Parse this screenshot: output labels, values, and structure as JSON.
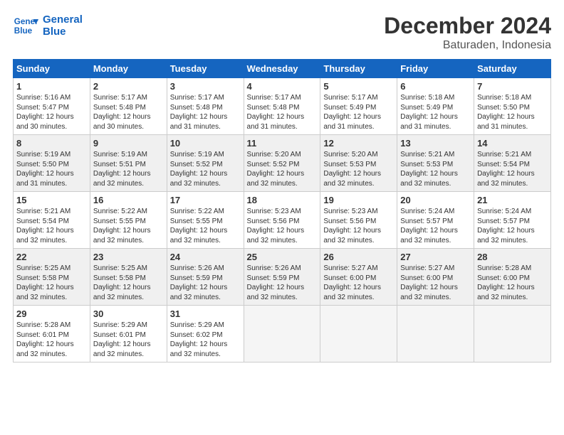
{
  "logo": {
    "line1": "General",
    "line2": "Blue"
  },
  "title": "December 2024",
  "subtitle": "Baturaden, Indonesia",
  "days_of_week": [
    "Sunday",
    "Monday",
    "Tuesday",
    "Wednesday",
    "Thursday",
    "Friday",
    "Saturday"
  ],
  "weeks": [
    [
      {
        "day": "1",
        "info": "Sunrise: 5:16 AM\nSunset: 5:47 PM\nDaylight: 12 hours\nand 30 minutes."
      },
      {
        "day": "2",
        "info": "Sunrise: 5:17 AM\nSunset: 5:48 PM\nDaylight: 12 hours\nand 30 minutes."
      },
      {
        "day": "3",
        "info": "Sunrise: 5:17 AM\nSunset: 5:48 PM\nDaylight: 12 hours\nand 31 minutes."
      },
      {
        "day": "4",
        "info": "Sunrise: 5:17 AM\nSunset: 5:48 PM\nDaylight: 12 hours\nand 31 minutes."
      },
      {
        "day": "5",
        "info": "Sunrise: 5:17 AM\nSunset: 5:49 PM\nDaylight: 12 hours\nand 31 minutes."
      },
      {
        "day": "6",
        "info": "Sunrise: 5:18 AM\nSunset: 5:49 PM\nDaylight: 12 hours\nand 31 minutes."
      },
      {
        "day": "7",
        "info": "Sunrise: 5:18 AM\nSunset: 5:50 PM\nDaylight: 12 hours\nand 31 minutes."
      }
    ],
    [
      {
        "day": "8",
        "info": "Sunrise: 5:19 AM\nSunset: 5:50 PM\nDaylight: 12 hours\nand 31 minutes."
      },
      {
        "day": "9",
        "info": "Sunrise: 5:19 AM\nSunset: 5:51 PM\nDaylight: 12 hours\nand 32 minutes."
      },
      {
        "day": "10",
        "info": "Sunrise: 5:19 AM\nSunset: 5:52 PM\nDaylight: 12 hours\nand 32 minutes."
      },
      {
        "day": "11",
        "info": "Sunrise: 5:20 AM\nSunset: 5:52 PM\nDaylight: 12 hours\nand 32 minutes."
      },
      {
        "day": "12",
        "info": "Sunrise: 5:20 AM\nSunset: 5:53 PM\nDaylight: 12 hours\nand 32 minutes."
      },
      {
        "day": "13",
        "info": "Sunrise: 5:21 AM\nSunset: 5:53 PM\nDaylight: 12 hours\nand 32 minutes."
      },
      {
        "day": "14",
        "info": "Sunrise: 5:21 AM\nSunset: 5:54 PM\nDaylight: 12 hours\nand 32 minutes."
      }
    ],
    [
      {
        "day": "15",
        "info": "Sunrise: 5:21 AM\nSunset: 5:54 PM\nDaylight: 12 hours\nand 32 minutes."
      },
      {
        "day": "16",
        "info": "Sunrise: 5:22 AM\nSunset: 5:55 PM\nDaylight: 12 hours\nand 32 minutes."
      },
      {
        "day": "17",
        "info": "Sunrise: 5:22 AM\nSunset: 5:55 PM\nDaylight: 12 hours\nand 32 minutes."
      },
      {
        "day": "18",
        "info": "Sunrise: 5:23 AM\nSunset: 5:56 PM\nDaylight: 12 hours\nand 32 minutes."
      },
      {
        "day": "19",
        "info": "Sunrise: 5:23 AM\nSunset: 5:56 PM\nDaylight: 12 hours\nand 32 minutes."
      },
      {
        "day": "20",
        "info": "Sunrise: 5:24 AM\nSunset: 5:57 PM\nDaylight: 12 hours\nand 32 minutes."
      },
      {
        "day": "21",
        "info": "Sunrise: 5:24 AM\nSunset: 5:57 PM\nDaylight: 12 hours\nand 32 minutes."
      }
    ],
    [
      {
        "day": "22",
        "info": "Sunrise: 5:25 AM\nSunset: 5:58 PM\nDaylight: 12 hours\nand 32 minutes."
      },
      {
        "day": "23",
        "info": "Sunrise: 5:25 AM\nSunset: 5:58 PM\nDaylight: 12 hours\nand 32 minutes."
      },
      {
        "day": "24",
        "info": "Sunrise: 5:26 AM\nSunset: 5:59 PM\nDaylight: 12 hours\nand 32 minutes."
      },
      {
        "day": "25",
        "info": "Sunrise: 5:26 AM\nSunset: 5:59 PM\nDaylight: 12 hours\nand 32 minutes."
      },
      {
        "day": "26",
        "info": "Sunrise: 5:27 AM\nSunset: 6:00 PM\nDaylight: 12 hours\nand 32 minutes."
      },
      {
        "day": "27",
        "info": "Sunrise: 5:27 AM\nSunset: 6:00 PM\nDaylight: 12 hours\nand 32 minutes."
      },
      {
        "day": "28",
        "info": "Sunrise: 5:28 AM\nSunset: 6:00 PM\nDaylight: 12 hours\nand 32 minutes."
      }
    ],
    [
      {
        "day": "29",
        "info": "Sunrise: 5:28 AM\nSunset: 6:01 PM\nDaylight: 12 hours\nand 32 minutes."
      },
      {
        "day": "30",
        "info": "Sunrise: 5:29 AM\nSunset: 6:01 PM\nDaylight: 12 hours\nand 32 minutes."
      },
      {
        "day": "31",
        "info": "Sunrise: 5:29 AM\nSunset: 6:02 PM\nDaylight: 12 hours\nand 32 minutes."
      },
      null,
      null,
      null,
      null
    ]
  ],
  "shaded_rows": [
    1,
    3
  ]
}
